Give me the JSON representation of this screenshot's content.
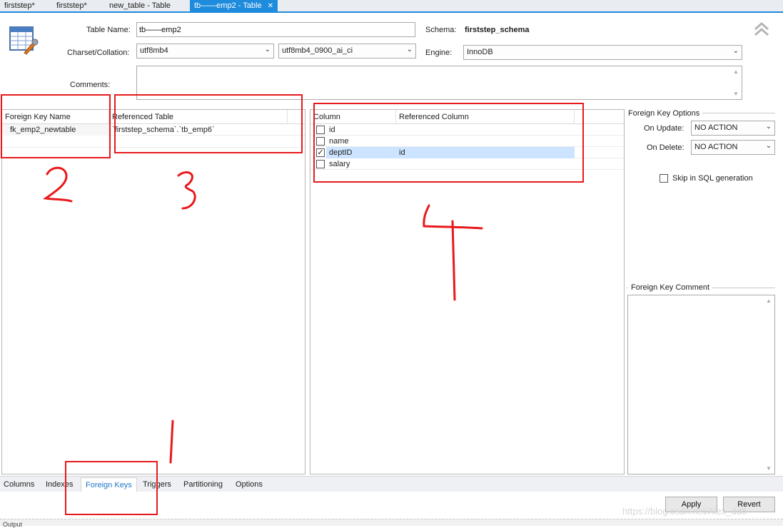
{
  "tabs": [
    {
      "label": "firststep*"
    },
    {
      "label": "firststep*"
    },
    {
      "label": "new_table - Table"
    },
    {
      "label": "tb——emp2 - Table",
      "close": "✕"
    }
  ],
  "header": {
    "table_name_label": "Table Name:",
    "table_name_value": "tb——emp2",
    "schema_label": "Schema:",
    "schema_value": "firststep_schema",
    "charset_label": "Charset/Collation:",
    "charset_value": "utf8mb4",
    "collation_value": "utf8mb4_0900_ai_ci",
    "engine_label": "Engine:",
    "engine_value": "InnoDB",
    "comments_label": "Comments:"
  },
  "fk_list": {
    "columns": [
      "Foreign Key Name",
      "Referenced Table"
    ],
    "rows": [
      {
        "name": "fk_emp2_newtable",
        "table": "`firststep_schema`.`tb_emp6`"
      }
    ]
  },
  "column_map": {
    "columns": [
      "Column",
      "Referenced Column"
    ],
    "rows": [
      {
        "column": "id",
        "checked": false,
        "ref": ""
      },
      {
        "column": "name",
        "checked": false,
        "ref": ""
      },
      {
        "column": "deptID",
        "checked": true,
        "ref": "id"
      },
      {
        "column": "salary",
        "checked": false,
        "ref": ""
      }
    ]
  },
  "options": {
    "title": "Foreign Key Options",
    "on_update_label": "On Update:",
    "on_update_value": "NO ACTION",
    "on_delete_label": "On Delete:",
    "on_delete_value": "NO ACTION",
    "skip_label": "Skip in SQL generation",
    "comment_title": "Foreign Key Comment"
  },
  "bottom_tabs": [
    "Columns",
    "Indexes",
    "Foreign Keys",
    "Triggers",
    "Partitioning",
    "Options"
  ],
  "active_bottom_tab": "Foreign Keys",
  "buttons": {
    "apply": "Apply",
    "revert": "Revert"
  },
  "annotations": [
    "1",
    "2",
    "3",
    "4"
  ],
  "watermark": "https://blog.csdn.net/Alex_dd8",
  "output_label": "Output",
  "colors": {
    "accent": "#1e8bdc",
    "annotation": "#e8191c",
    "selection": "#cce4ff"
  }
}
